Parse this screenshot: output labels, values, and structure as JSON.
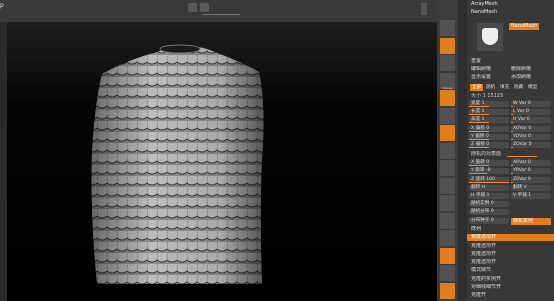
{
  "top": {
    "title": "p"
  },
  "strip": [
    {
      "label": "",
      "orange": false
    },
    {
      "label": "",
      "orange": true
    },
    {
      "label": "",
      "orange": false
    },
    {
      "label": "Sweep",
      "orange": false
    },
    {
      "label": "",
      "orange": true
    },
    {
      "label": "",
      "orange": false
    },
    {
      "label": "",
      "orange": true
    },
    {
      "label": "",
      "orange": false
    },
    {
      "label": "",
      "orange": false
    },
    {
      "label": "",
      "orange": false
    },
    {
      "label": "",
      "orange": false
    },
    {
      "label": "",
      "orange": false
    },
    {
      "label": "",
      "orange": false
    },
    {
      "label": "",
      "orange": true
    },
    {
      "label": "",
      "orange": false
    },
    {
      "label": "",
      "orange": true
    }
  ],
  "panel": {
    "top_lines": [
      "ArrayMesh",
      "NanoMesh"
    ],
    "nanomesh_btn": "NanoMesh 开",
    "rows": [
      {
        "text": "重置",
        "text2": "",
        "type": "btn"
      },
      {
        "text": "编辑刷槽",
        "text2": "删除刷槽",
        "type": "btn"
      },
      {
        "text": "显示设置",
        "text2": "添加刷槽",
        "type": "btn"
      }
    ],
    "tabs": [
      "全部",
      "随机",
      "填充",
      "隐藏",
      "模型"
    ],
    "count": "大小 1 15125",
    "sliders": [
      {
        "a": "宽度 1",
        "b": "W Var 0",
        "fa": 0.5,
        "fb": 0.05
      },
      {
        "a": "长度 1",
        "b": "L Var 0",
        "fa": 0.5,
        "fb": 0.05
      },
      {
        "a": "高度 1",
        "b": "H Var 0",
        "fa": 0.5,
        "fb": 0.05
      },
      {
        "a": "X 偏移 0",
        "b": "XOVar 0",
        "fa": 0.5,
        "fb": 0.05
      },
      {
        "a": "Y 偏移 0",
        "b": "YOVar 0",
        "fa": 0.5,
        "fb": 0.05
      },
      {
        "a": "Z 偏移 0",
        "b": "ZOVar 0",
        "fa": 0.5,
        "fb": 0.05
      }
    ],
    "rand_rotate": "随机向对表面",
    "rot_sliders": [
      {
        "a": "X 旋转 0",
        "b": "XRVar 0",
        "fa": 0.5,
        "fb": 0.05
      },
      {
        "a": "Y 旋转 -8",
        "b": "YRVar 0",
        "fa": 0.45,
        "fb": 0.05
      },
      {
        "a": "Z 旋转 180",
        "b": "ZRVar 0",
        "fa": 1.0,
        "fb": 0.05
      }
    ],
    "flip": {
      "a": "翻转 H",
      "b": "翻转 V"
    },
    "flat": {
      "a": "H 平铺 1",
      "b": "V 平铺 1"
    },
    "misc": [
      "随机实例 0",
      "随机分布 0",
      "分布种子 0"
    ],
    "orange_row": "随机实例",
    "list_hdr": "阵列",
    "list_selected": "克隆选项开",
    "list": [
      "克隆选项开",
      "克隆选项开",
      "克隆选项开",
      "模式细节",
      "克隆的实例开",
      "对细线细节开",
      "克隆开"
    ]
  }
}
